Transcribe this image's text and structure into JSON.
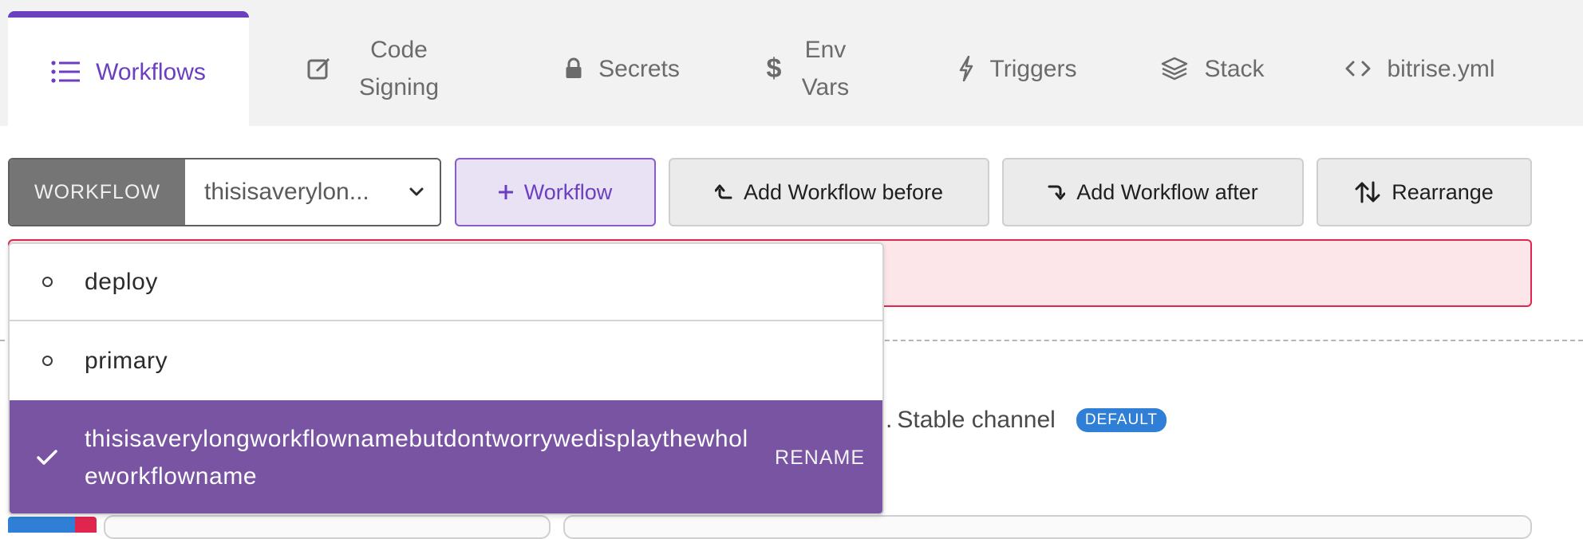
{
  "tabs": [
    {
      "label": "Workflows",
      "icon": "list-icon",
      "active": true
    },
    {
      "label": "Code Signing",
      "icon": "edit-icon"
    },
    {
      "label": "Secrets",
      "icon": "lock-icon"
    },
    {
      "label": "Env Vars",
      "icon": "dollar-icon"
    },
    {
      "label": "Triggers",
      "icon": "bolt-icon"
    },
    {
      "label": "Stack",
      "icon": "layers-icon"
    },
    {
      "label": "bitrise.yml",
      "icon": "code-icon"
    }
  ],
  "toolbar": {
    "workflow_label": "WORKFLOW",
    "workflow_value": "thisisaverylon...",
    "add_workflow": "Workflow",
    "add_before": "Add Workflow before",
    "add_after": "Add Workflow after",
    "rearrange": "Rearrange"
  },
  "dropdown": {
    "items": [
      {
        "name": "deploy",
        "selected": false
      },
      {
        "name": "primary",
        "selected": false
      },
      {
        "name": "thisisaverylongworkflownamebutdontworrywedisplaythewholeworkflowname",
        "selected": true
      }
    ],
    "rename_label": "RENAME"
  },
  "stack": {
    "text_prefix": ".",
    "text": "Stable channel",
    "badge": "DEFAULT"
  },
  "colors": {
    "accent": "#6c3fc0",
    "selected_bg": "#7854a3",
    "error_border": "#e0264f",
    "error_bg": "#fce6ea",
    "badge_bg": "#2f7fd6"
  }
}
